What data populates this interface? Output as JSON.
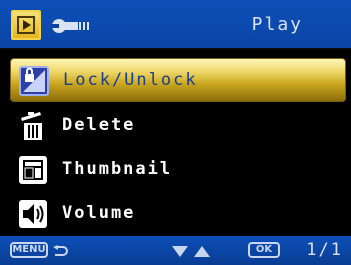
{
  "header": {
    "title": "Play",
    "tabs": [
      {
        "icon": "play-icon"
      },
      {
        "icon": "wrench-icon"
      }
    ]
  },
  "menu": {
    "items": [
      {
        "label": "Lock/Unlock",
        "icon": "lock-icon",
        "selected": true
      },
      {
        "label": "Delete",
        "icon": "trash-icon",
        "selected": false
      },
      {
        "label": "Thumbnail",
        "icon": "thumbnail-icon",
        "selected": false
      },
      {
        "label": "Volume",
        "icon": "speaker-icon",
        "selected": false
      }
    ]
  },
  "footer": {
    "menu_button": "MENU",
    "ok_button": "OK",
    "page": "1/1"
  },
  "colors": {
    "bar_blue": "#0d4fb8",
    "highlight_gold": "#efd86a",
    "selected_text": "#1b3f8a"
  }
}
